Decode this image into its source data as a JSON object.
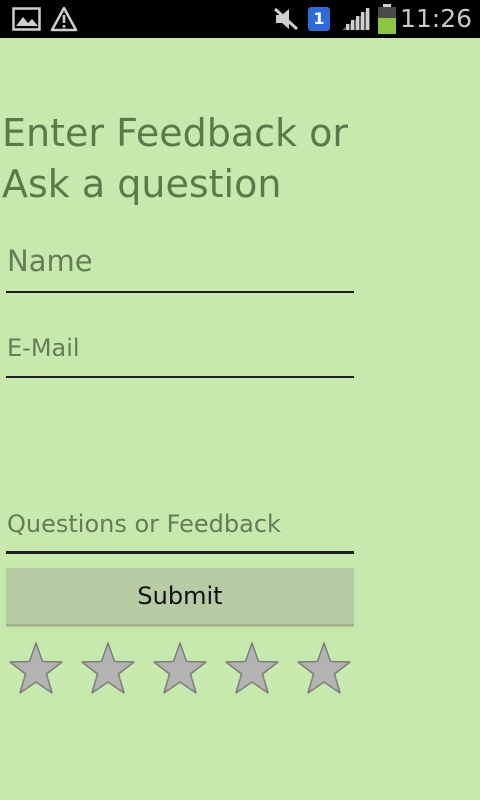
{
  "status_bar": {
    "time": "11:26",
    "sim_number": "1",
    "icons": [
      "picture-icon",
      "warning-icon",
      "mute-icon",
      "sim-icon",
      "signal-icon",
      "battery-icon"
    ]
  },
  "form": {
    "title": "Enter Feedback or Ask a question",
    "name_placeholder": "Name",
    "email_placeholder": "E-Mail",
    "feedback_placeholder": "Questions or Feedback",
    "submit_label": "Submit",
    "rating": {
      "value": 0,
      "max": 5
    }
  },
  "colors": {
    "background": "#c8e9ad",
    "title_text": "#5b7a4a",
    "placeholder_text": "#647d57",
    "button_background": "#b7cba4",
    "star_fill": "#b3b3b3",
    "star_stroke": "#7d7d7d"
  }
}
